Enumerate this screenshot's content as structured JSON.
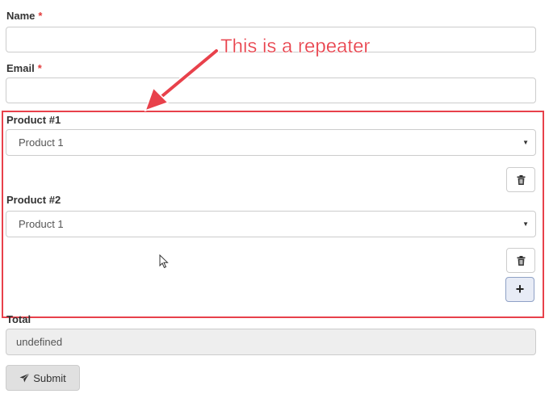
{
  "form": {
    "name_label": "Name",
    "email_label": "Email",
    "required_mark": "*",
    "total_label": "Total",
    "total_value": "undefined",
    "submit_label": "Submit"
  },
  "repeater": {
    "items": [
      {
        "label": "Product #1",
        "selected": "Product 1"
      },
      {
        "label": "Product #2",
        "selected": "Product 1"
      }
    ],
    "add_label": "+"
  },
  "annotation": {
    "text": "This is a repeater",
    "color": "#e8414b"
  },
  "icons": {
    "remove": "trash-icon",
    "submit": "paper-plane-icon",
    "select_arrow": "caret-down-icon"
  },
  "colors": {
    "required": "#e23b3b",
    "highlight": "#e8414b",
    "readonly_bg": "#eeeeee"
  }
}
